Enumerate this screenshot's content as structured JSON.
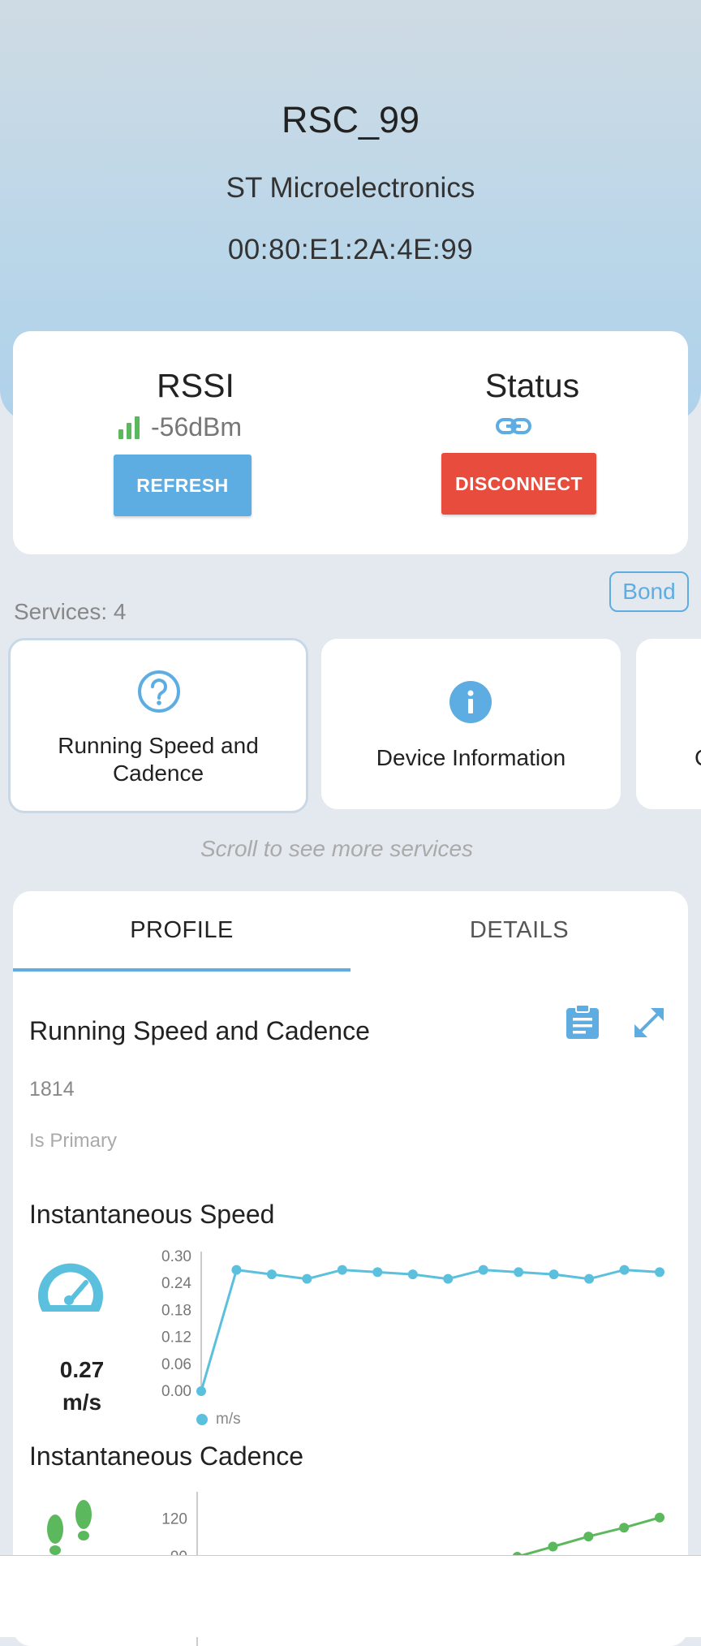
{
  "device": {
    "name": "RSC_99",
    "manufacturer": "ST Microelectronics",
    "address": "00:80:E1:2A:4E:99"
  },
  "connection": {
    "rssi_title": "RSSI",
    "rssi_value": "-56dBm",
    "signal_icon": "signal-bars-icon",
    "refresh_label": "REFRESH",
    "status_title": "Status",
    "status_icon": "link-icon",
    "disconnect_label": "DISCONNECT"
  },
  "services": {
    "bond_label": "Bond",
    "count_label": "Services: 4",
    "items": [
      {
        "label": "Running Speed and Cadence",
        "icon": "question-circle-icon"
      },
      {
        "label": "Device Information",
        "icon": "info-circle-icon"
      },
      {
        "label": "C",
        "icon": ""
      }
    ],
    "scroll_hint": "Scroll to see more services"
  },
  "tabs": [
    {
      "label": "PROFILE",
      "active": true
    },
    {
      "label": "DETAILS",
      "active": false
    }
  ],
  "profile": {
    "service_name": "Running Speed and Cadence",
    "uuid": "1814",
    "primary_label": "Is Primary",
    "speed": {
      "title": "Instantaneous Speed",
      "value": "0.27",
      "unit": "m/s",
      "icon": "speedometer-icon"
    },
    "cadence": {
      "title": "Instantaneous Cadence",
      "icon": "footsteps-icon"
    }
  },
  "colors": {
    "accent": "#5dade2",
    "danger": "#e74c3c",
    "speed_line": "#5bc0de",
    "cadence_line": "#5cb85c"
  },
  "chart_data": [
    {
      "type": "line",
      "series": [
        {
          "name": "m/s",
          "values": [
            0.0,
            0.27,
            0.26,
            0.25,
            0.27,
            0.265,
            0.26,
            0.25,
            0.27,
            0.265,
            0.26,
            0.25,
            0.27,
            0.265
          ]
        }
      ],
      "x": [
        0,
        1,
        2,
        3,
        4,
        5,
        6,
        7,
        8,
        9,
        10,
        11,
        12,
        13
      ],
      "yticks": [
        "0.00",
        "0.06",
        "0.12",
        "0.18",
        "0.24",
        "0.30"
      ],
      "ylim": [
        0,
        0.3
      ],
      "legend": "bottom-left"
    },
    {
      "type": "line",
      "series": [
        {
          "name": "",
          "values": [
            null,
            null,
            null,
            null,
            null,
            null,
            null,
            null,
            80,
            90,
            98,
            106,
            113,
            121
          ]
        }
      ],
      "x": [
        0,
        1,
        2,
        3,
        4,
        5,
        6,
        7,
        8,
        9,
        10,
        11,
        12,
        13
      ],
      "yticks": [
        "90",
        "120"
      ],
      "ylim": [
        0,
        135
      ]
    }
  ]
}
